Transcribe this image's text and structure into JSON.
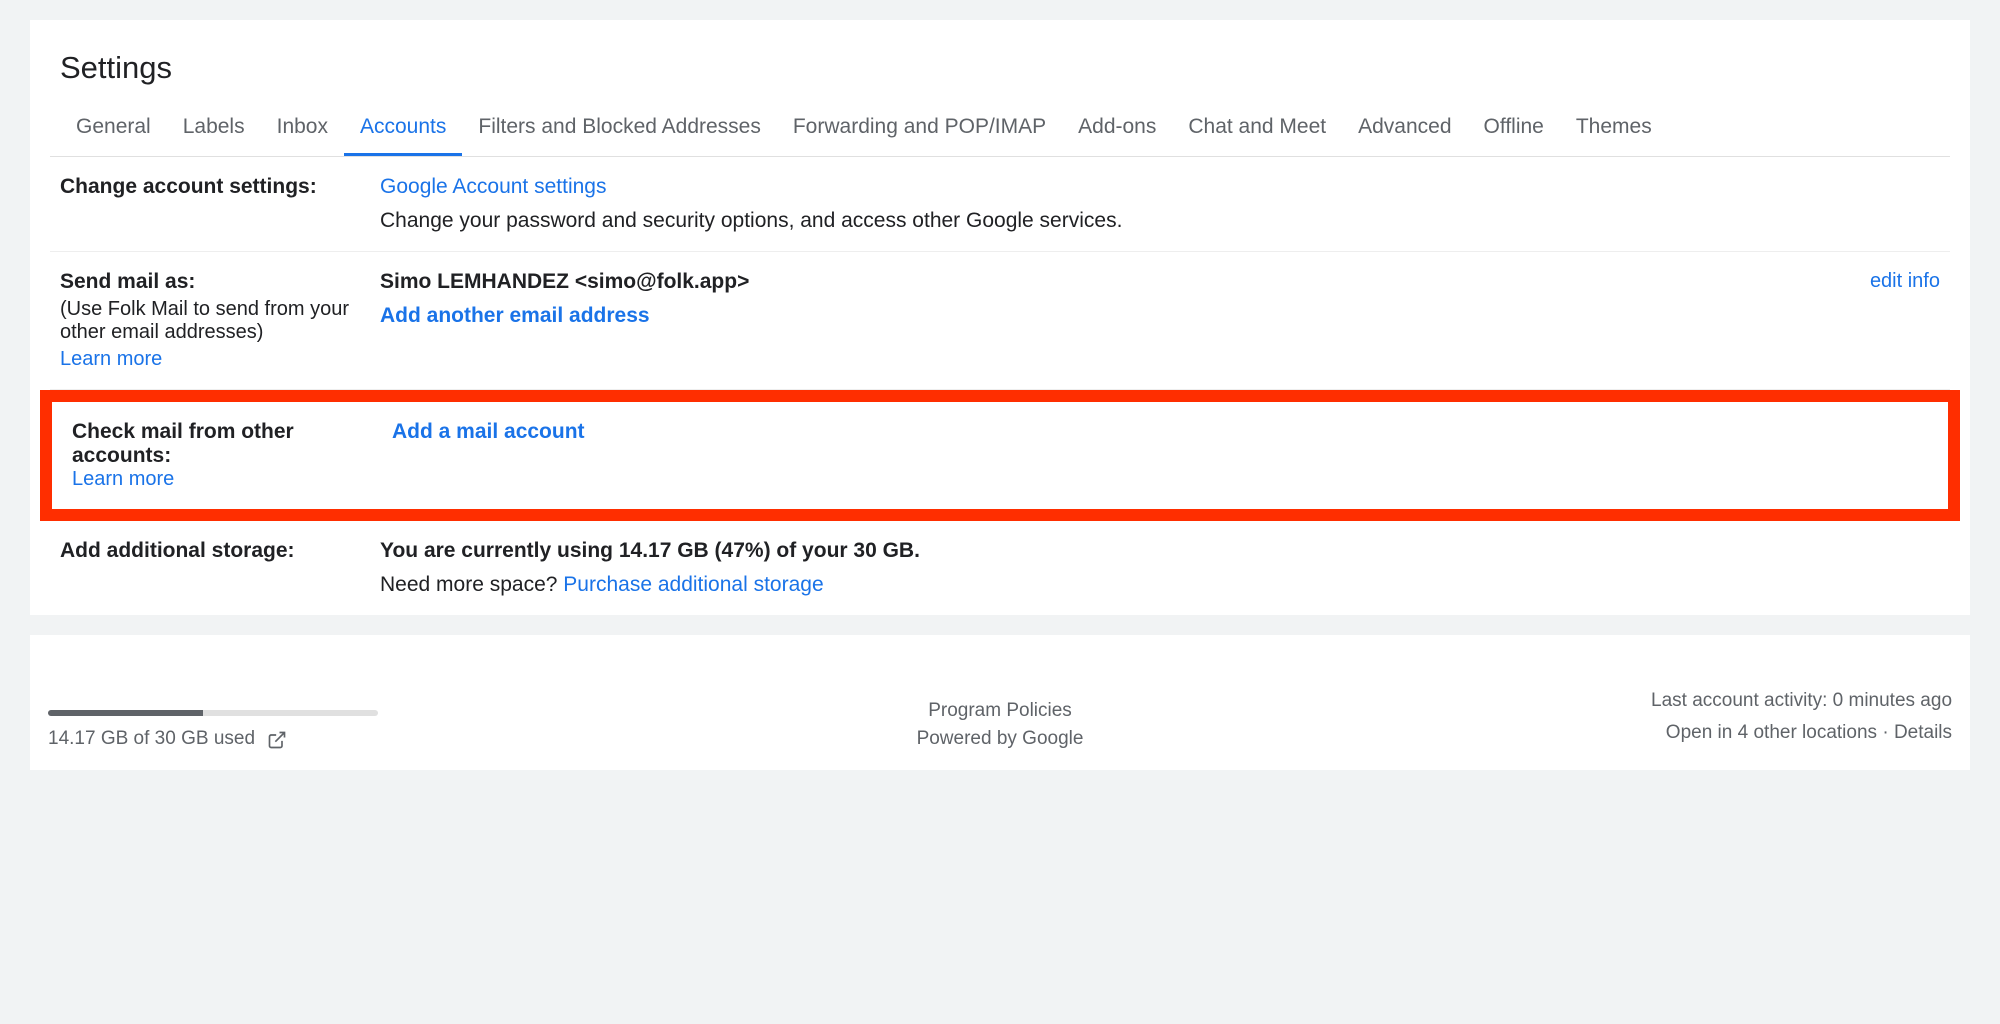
{
  "pageTitle": "Settings",
  "tabs": {
    "general": "General",
    "labels": "Labels",
    "inbox": "Inbox",
    "accounts": "Accounts",
    "filters": "Filters and Blocked Addresses",
    "forwarding": "Forwarding and POP/IMAP",
    "addons": "Add-ons",
    "chat": "Chat and Meet",
    "advanced": "Advanced",
    "offline": "Offline",
    "themes": "Themes"
  },
  "sections": {
    "changeAccount": {
      "label": "Change account settings:",
      "link": "Google Account settings",
      "desc": "Change your password and security options, and access other Google services."
    },
    "sendMailAs": {
      "label": "Send mail as:",
      "desc": "(Use Folk Mail to send from your other email addresses)",
      "learnMore": "Learn more",
      "email": "Simo LEMHANDEZ <simo@folk.app>",
      "addLink": "Add another email address",
      "editInfo": "edit info"
    },
    "checkMail": {
      "label": "Check mail from other accounts:",
      "learnMore": "Learn more",
      "addLink": "Add a mail account"
    },
    "storage": {
      "label": "Add additional storage:",
      "usage": "You are currently using 14.17 GB (47%) of your 30 GB.",
      "prompt": "Need more space? ",
      "purchaseLink": "Purchase additional storage"
    }
  },
  "footer": {
    "storageUsed": "14.17 GB of 30 GB used",
    "programPolicies": "Program Policies",
    "poweredBy": "Powered by Google",
    "activity": "Last account activity: 0 minutes ago",
    "locations": "Open in 4 other locations · ",
    "details": "Details"
  }
}
